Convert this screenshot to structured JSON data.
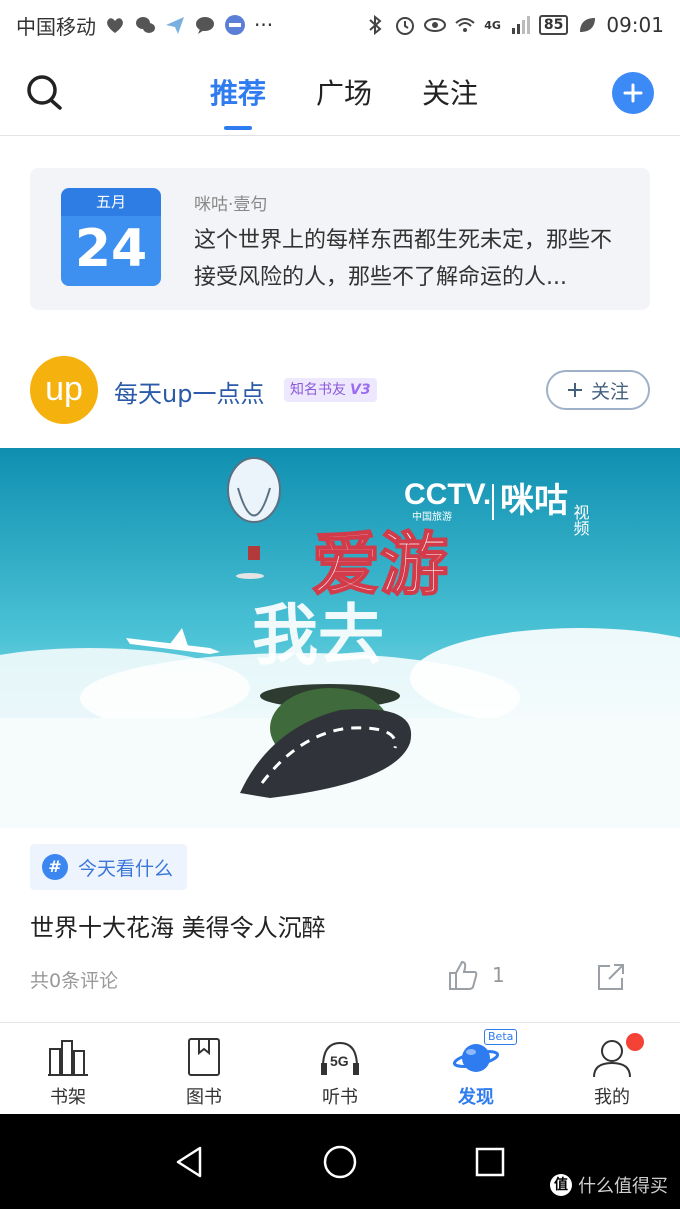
{
  "status_bar": {
    "carrier": "中国移动",
    "dots": "···",
    "network": "4G",
    "battery": "85",
    "time": "09:01"
  },
  "top_nav": {
    "tabs": [
      {
        "label": "推荐",
        "active": true
      },
      {
        "label": "广场",
        "active": false
      },
      {
        "label": "关注",
        "active": false
      }
    ]
  },
  "quote_card": {
    "calendar_month": "五月",
    "calendar_day": "24",
    "source": "咪咕·壹句",
    "text": "这个世界上的每样东西都生死未定，那些不接受风险的人，那些不了解命运的人..."
  },
  "post": {
    "avatar_text": "up",
    "username": "每天up一点点",
    "badge": "知名书友",
    "badge_level": "V3",
    "follow_label": "关注",
    "hero": {
      "brand_left": "CCTV.",
      "brand_sub": "中国旅游",
      "brand_right": "咪咕",
      "brand_right_sub": "视频",
      "title_line1": "爱游",
      "title_line2": "我去"
    },
    "topic": "今天看什么",
    "title": "世界十大花海 美得令人沉醉",
    "comments": "共0条评论",
    "likes": "1"
  },
  "bottom_tabs": [
    {
      "label": "书架",
      "icon": "bookshelf-icon"
    },
    {
      "label": "图书",
      "icon": "book-icon"
    },
    {
      "label": "听书",
      "icon": "5g-headphones-icon"
    },
    {
      "label": "发现",
      "icon": "planet-icon",
      "badge": "Beta",
      "active": true
    },
    {
      "label": "我的",
      "icon": "user-icon"
    }
  ],
  "watermark": {
    "logo": "值",
    "text": "什么值得买"
  },
  "colors": {
    "accent": "#2f7bf0",
    "avatar": "#f5b20f",
    "badge_bg": "#eee8ff"
  }
}
